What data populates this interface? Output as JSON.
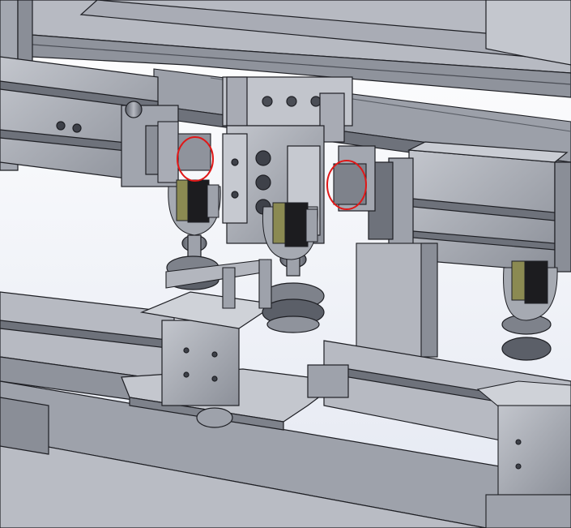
{
  "scene": {
    "kind": "cad-model-render",
    "background": "#ffffff",
    "palette": {
      "metal_light": "#b9bcc4",
      "metal_mid": "#9ea2ab",
      "metal_dark": "#6e727b",
      "metal_shadow": "#4a4d55",
      "line": "#1e1f24",
      "sensor_yellow": "#8b8a52",
      "sensor_black": "#1c1c1f",
      "highlight_red": "#e01818",
      "sky_blue": "#e9edf6"
    },
    "highlights": [
      {
        "name": "left-flag-circle"
      },
      {
        "name": "right-flag-circle"
      }
    ],
    "sensors": [
      {
        "name": "sensor-left"
      },
      {
        "name": "sensor-center"
      },
      {
        "name": "sensor-right"
      }
    ]
  }
}
